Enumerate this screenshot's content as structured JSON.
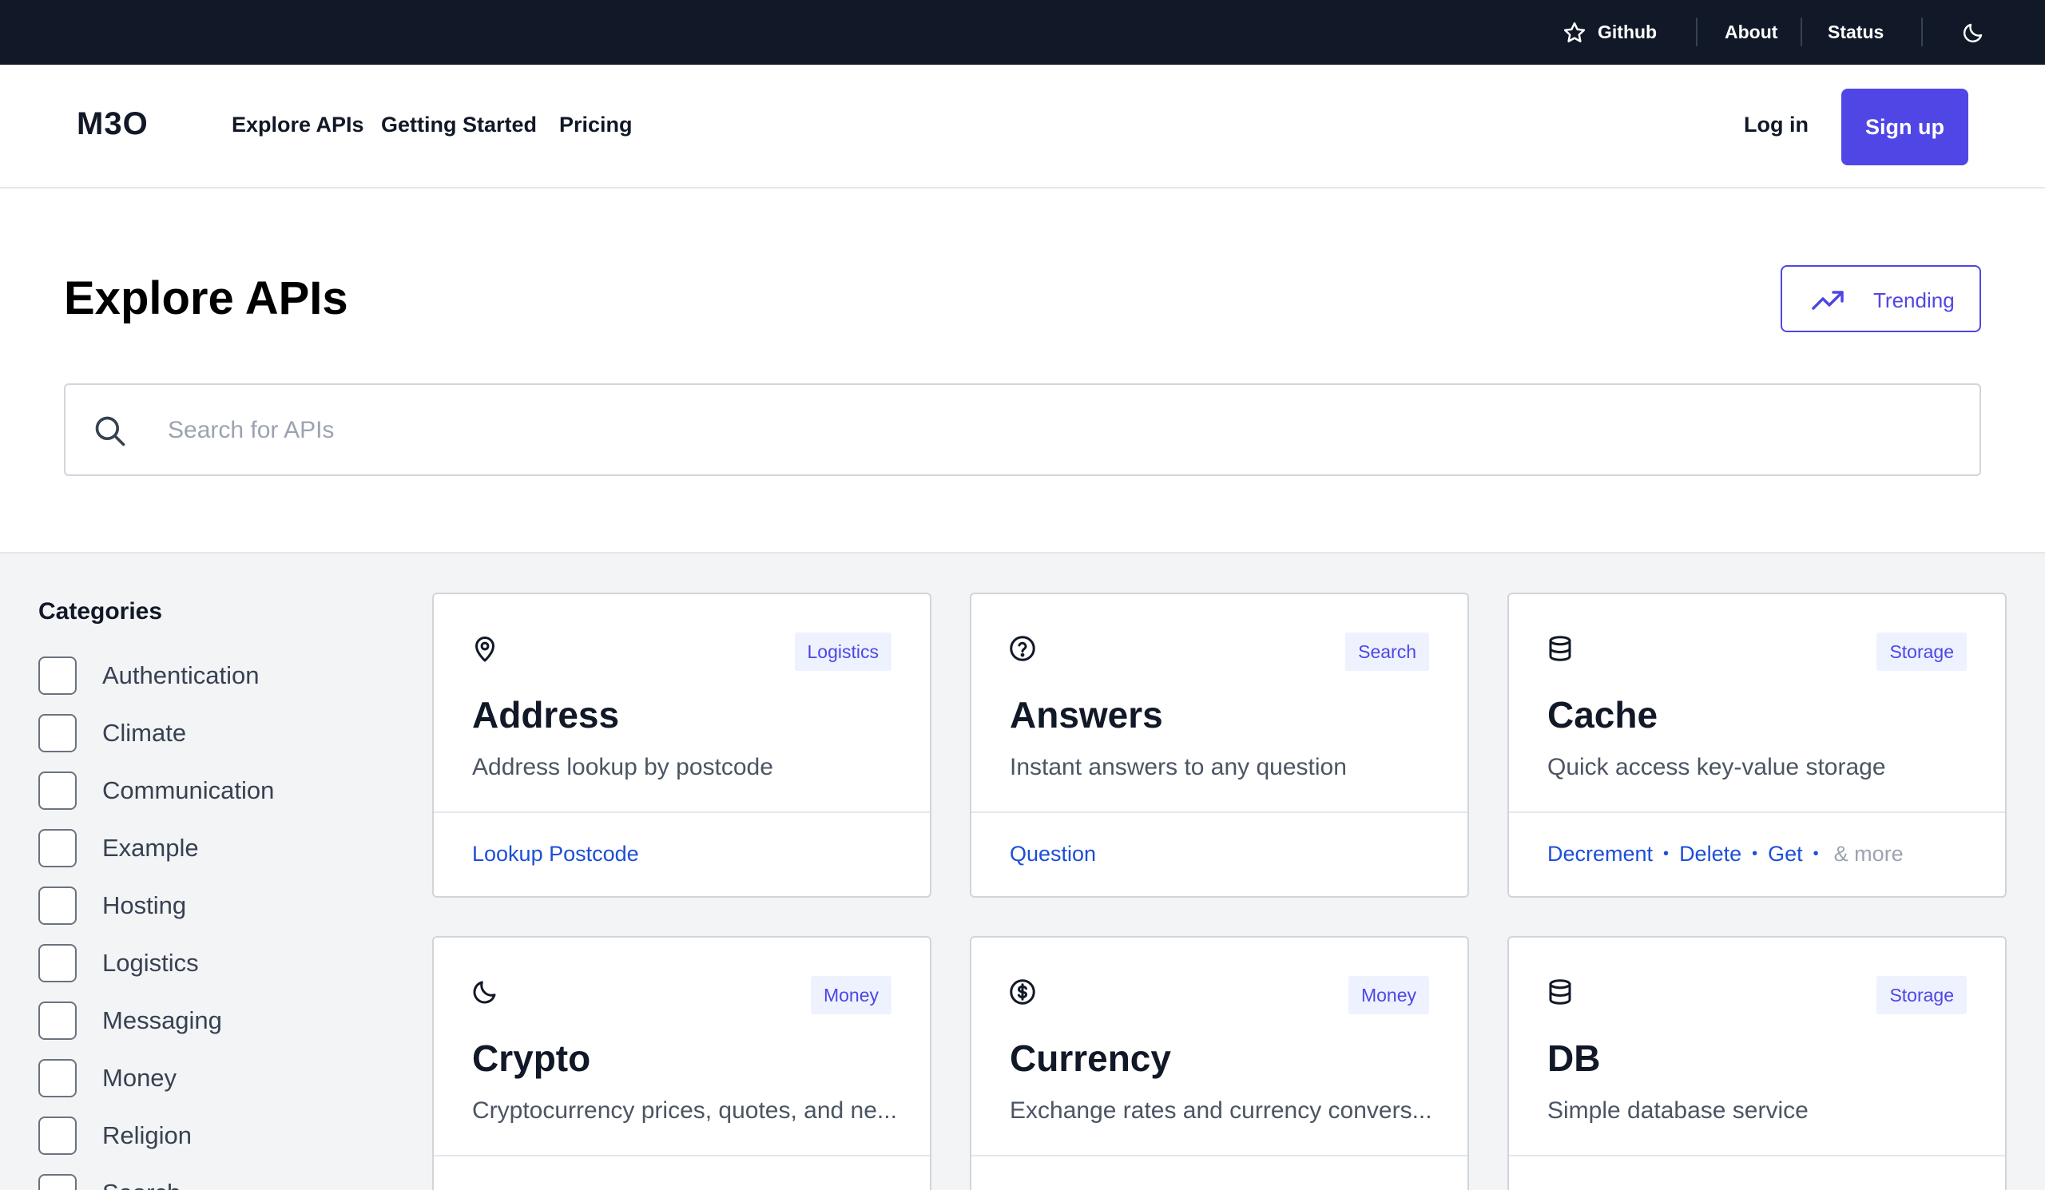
{
  "topbar": {
    "github_label": "Github",
    "about_label": "About",
    "status_label": "Status"
  },
  "header": {
    "logo": "M3O",
    "nav": [
      "Explore APIs",
      "Getting Started",
      "Pricing"
    ],
    "login_label": "Log in",
    "signup_label": "Sign up"
  },
  "hero": {
    "title": "Explore APIs",
    "trending_label": "Trending",
    "search_placeholder": "Search for APIs"
  },
  "categories": {
    "title": "Categories",
    "items": [
      "Authentication",
      "Climate",
      "Communication",
      "Example",
      "Hosting",
      "Logistics",
      "Messaging",
      "Money",
      "Religion",
      "Search"
    ]
  },
  "cards": [
    {
      "icon": "location-pin-icon",
      "tag": "Logistics",
      "name": "Address",
      "description": "Address lookup by postcode",
      "endpoints": [
        "Lookup Postcode"
      ],
      "more": ""
    },
    {
      "icon": "question-circle-icon",
      "tag": "Search",
      "name": "Answers",
      "description": "Instant answers to any question",
      "endpoints": [
        "Question"
      ],
      "more": ""
    },
    {
      "icon": "database-icon",
      "tag": "Storage",
      "name": "Cache",
      "description": "Quick access key-value storage",
      "endpoints": [
        "Decrement",
        "Delete",
        "Get"
      ],
      "more": "& more"
    },
    {
      "icon": "moon-icon",
      "tag": "Money",
      "name": "Crypto",
      "description": "Cryptocurrency prices, quotes, and ne...",
      "endpoints": [],
      "more": ""
    },
    {
      "icon": "dollar-circle-icon",
      "tag": "Money",
      "name": "Currency",
      "description": "Exchange rates and currency convers...",
      "endpoints": [],
      "more": ""
    },
    {
      "icon": "database-icon",
      "tag": "Storage",
      "name": "DB",
      "description": "Simple database service",
      "endpoints": [],
      "more": ""
    }
  ],
  "colors": {
    "topbar_bg": "#111827",
    "accent": "#4f46e5",
    "link": "#1d4ed8",
    "tag_bg": "#eef2ff",
    "main_bg": "#f3f4f6"
  }
}
